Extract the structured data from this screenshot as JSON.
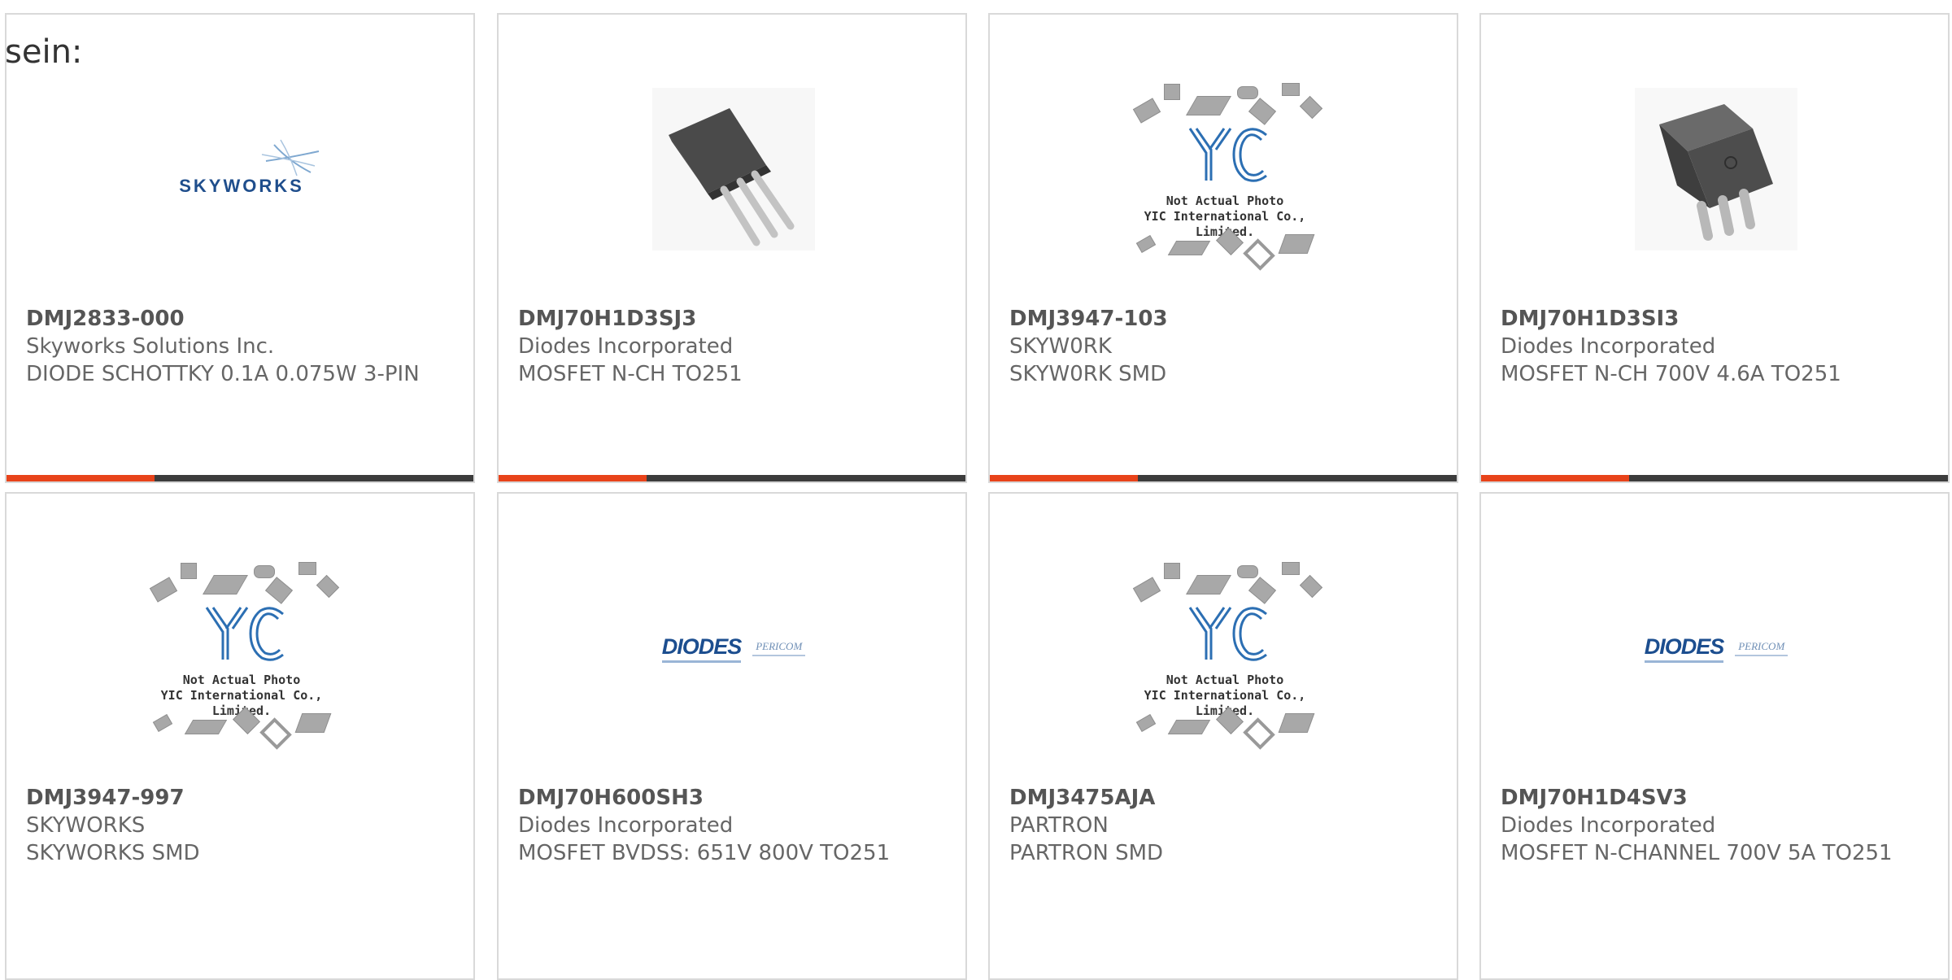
{
  "intro_text": "sein:",
  "colors": {
    "accent": "#e8431a",
    "bar": "#3c3c3c",
    "border": "#d9d9d9"
  },
  "products": [
    {
      "part_number": "DMJ2833-000",
      "manufacturer": "Skyworks Solutions Inc.",
      "description": "DIODE SCHOTTKY 0.1A 0.075W 3-PIN",
      "image": "skyworks-logo",
      "logo_text": "SKYWORKS"
    },
    {
      "part_number": "DMJ70H1D3SJ3",
      "manufacturer": "Diodes Incorporated",
      "description": "MOSFET N-CH TO251",
      "image": "to251-transistor-photo"
    },
    {
      "part_number": "DMJ3947-103",
      "manufacturer": "SKYW0RK",
      "description": "SKYW0RK SMD",
      "image": "yic-placeholder",
      "photo_note": "Not Actual Photo",
      "company": "YIC International Co., Limited."
    },
    {
      "part_number": "DMJ70H1D3SI3",
      "manufacturer": "Diodes Incorporated",
      "description": "MOSFET N-CH 700V 4.6A TO251",
      "image": "ipak-transistor-photo"
    },
    {
      "part_number": "DMJ3947-997",
      "manufacturer": "SKYWORKS",
      "description": "SKYWORKS SMD",
      "image": "yic-placeholder",
      "photo_note": "Not Actual Photo",
      "company": "YIC International Co., Limited."
    },
    {
      "part_number": "DMJ70H600SH3",
      "manufacturer": "Diodes Incorporated",
      "description": "MOSFET BVDSS: 651V 800V TO251",
      "image": "diodes-logo",
      "logo_text": "DIODES",
      "logo_text2": "PERICOM"
    },
    {
      "part_number": "DMJ3475AJA",
      "manufacturer": "PARTRON",
      "description": "PARTRON SMD",
      "image": "yic-placeholder",
      "photo_note": "Not Actual Photo",
      "company": "YIC International Co., Limited."
    },
    {
      "part_number": "DMJ70H1D4SV3",
      "manufacturer": "Diodes Incorporated",
      "description": "MOSFET N-CHANNEL 700V 5A TO251",
      "image": "diodes-logo",
      "logo_text": "DIODES",
      "logo_text2": "PERICOM"
    }
  ]
}
